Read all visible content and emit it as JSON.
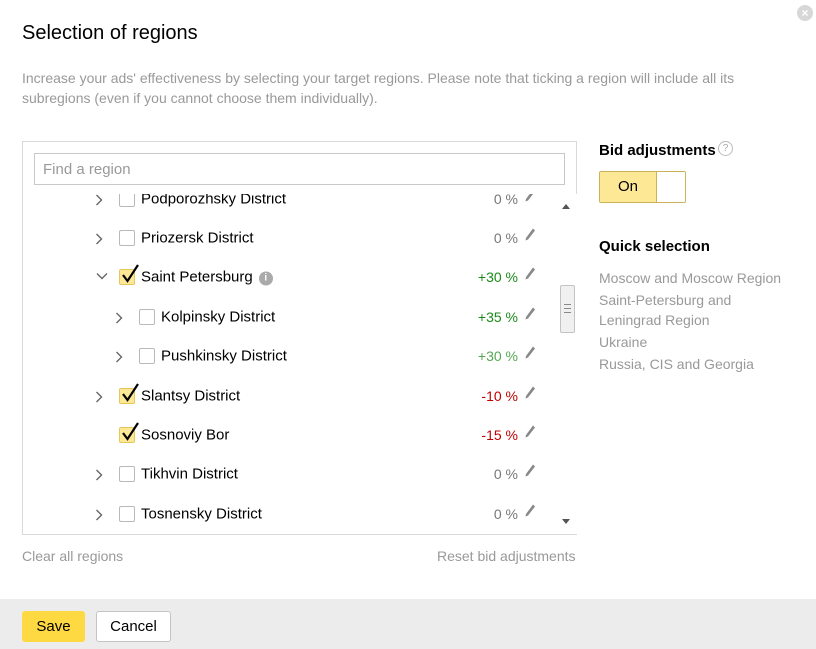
{
  "dialog": {
    "title": "Selection of regions",
    "description": "Increase your ads' effectiveness by selecting your target regions. Please note that ticking a region will include all its subregions (even if you cannot choose them individually).",
    "close_icon": "close-icon"
  },
  "search": {
    "placeholder": "Find a region",
    "value": ""
  },
  "regions": [
    {
      "label": "Podporozhsky District",
      "bid": "0 %",
      "bid_type": "zero",
      "checked": false,
      "expandable": true,
      "expanded": false,
      "level": 2
    },
    {
      "label": "Priozersk District",
      "bid": "0 %",
      "bid_type": "zero",
      "checked": false,
      "expandable": true,
      "expanded": false,
      "level": 2
    },
    {
      "label": "Saint Petersburg",
      "bid": "+30 %",
      "bid_type": "pos",
      "checked": true,
      "expandable": true,
      "expanded": true,
      "level": 2,
      "info": true
    },
    {
      "label": "Kolpinsky District",
      "bid": "+35 %",
      "bid_type": "pos",
      "checked": false,
      "expandable": true,
      "expanded": false,
      "level": 3
    },
    {
      "label": "Pushkinsky District",
      "bid": "+30 %",
      "bid_type": "pos-muted",
      "checked": false,
      "expandable": true,
      "expanded": false,
      "level": 3
    },
    {
      "label": "Slantsy District",
      "bid": "-10 %",
      "bid_type": "neg",
      "checked": true,
      "expandable": true,
      "expanded": false,
      "level": 2
    },
    {
      "label": "Sosnoviy Bor",
      "bid": "-15 %",
      "bid_type": "neg",
      "checked": true,
      "expandable": false,
      "expanded": false,
      "level": 2
    },
    {
      "label": "Tikhvin District",
      "bid": "0 %",
      "bid_type": "zero",
      "checked": false,
      "expandable": true,
      "expanded": false,
      "level": 2
    },
    {
      "label": "Tosnensky District",
      "bid": "0 %",
      "bid_type": "zero",
      "checked": false,
      "expandable": true,
      "expanded": false,
      "level": 2
    }
  ],
  "links": {
    "clear_all": "Clear all regions",
    "reset_bids": "Reset bid adjustments"
  },
  "bid_adjustments": {
    "title": "Bid adjustments",
    "help_icon": "question-icon",
    "toggle_label": "On",
    "toggle_state": true
  },
  "quick_selection": {
    "title": "Quick selection",
    "items": [
      "Moscow and Moscow Region",
      "Saint-Petersburg and\nLeningrad Region",
      "Ukraine",
      "Russia, CIS and Georgia"
    ]
  },
  "footer": {
    "save_label": "Save",
    "cancel_label": "Cancel"
  },
  "colors": {
    "accent_yellow": "#fed942",
    "checkbox_checked": "#fde896",
    "positive": "#1a8a1a",
    "negative": "#c00000",
    "muted": "#999999",
    "footer_bg": "#ececec"
  }
}
